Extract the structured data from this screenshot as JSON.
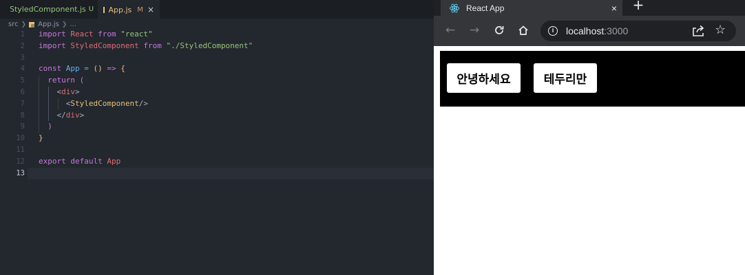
{
  "editor": {
    "tabs": [
      {
        "label": "StyledComponent.js",
        "flag": "U"
      },
      {
        "label": "App.js",
        "flag": "M",
        "close": "×"
      }
    ],
    "breadcrumb": {
      "folder": "src",
      "file": "App.js",
      "rest": "..."
    },
    "line_numbers": [
      "1",
      "2",
      "3",
      "4",
      "5",
      "6",
      "7",
      "8",
      "9",
      "10",
      "11",
      "12",
      "13"
    ],
    "current_line": "13",
    "code": {
      "l1": {
        "a": "import",
        "b": "React",
        "c": "from",
        "d": "\"react\""
      },
      "l2": {
        "a": "import",
        "b": "StyledComponent",
        "c": "from",
        "d": "\"./StyledComponent\""
      },
      "l4": {
        "a": "const",
        "b": "App",
        "c": "=",
        "d": "()",
        "e": "=>",
        "f": "{"
      },
      "l5": {
        "a": "return",
        "b": "("
      },
      "l6": {
        "a": "<",
        "b": "div",
        "c": ">"
      },
      "l7": {
        "a": "<",
        "b": "StyledComponent",
        "c": "/>"
      },
      "l8": {
        "a": "</",
        "b": "div",
        "c": ">"
      },
      "l9": {
        "a": ")"
      },
      "l10": {
        "a": "}"
      },
      "l12": {
        "a": "export",
        "b": "default",
        "c": "App"
      }
    }
  },
  "browser": {
    "tab_title": "React App",
    "tab_close": "×",
    "new_tab": "+",
    "url_host": "localhost",
    "url_port": ":3000",
    "buttons": [
      "안녕하세요",
      "테두리만"
    ]
  }
}
